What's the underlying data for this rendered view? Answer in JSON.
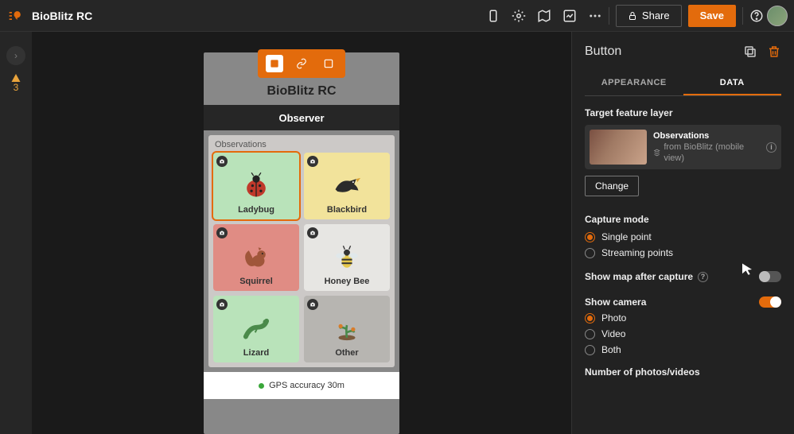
{
  "header": {
    "app_title": "BioBlitz RC",
    "share_label": "Share",
    "save_label": "Save"
  },
  "left_rail": {
    "warning_count": "3"
  },
  "phone": {
    "title": "BioBlitz RC",
    "observer_label": "Observer",
    "observations_title": "Observations",
    "gps_status": "GPS accuracy 30m",
    "cards": [
      {
        "label": "Ladybug",
        "bg": "#b9e3ba",
        "selected": true
      },
      {
        "label": "Blackbird",
        "bg": "#f2e39b",
        "selected": false
      },
      {
        "label": "Squirrel",
        "bg": "#e08c84",
        "selected": false
      },
      {
        "label": "Honey Bee",
        "bg": "#e7e6e3",
        "selected": false
      },
      {
        "label": "Lizard",
        "bg": "#b9e3ba",
        "selected": false
      },
      {
        "label": "Other",
        "bg": "#b7b5b1",
        "selected": false
      }
    ]
  },
  "panel": {
    "title": "Button",
    "tabs": {
      "appearance": "APPEARANCE",
      "data": "DATA"
    },
    "target_label": "Target feature layer",
    "layer_name": "Observations",
    "layer_source": "from BioBlitz (mobile view)",
    "change_label": "Change",
    "capture_mode_label": "Capture mode",
    "capture_options": {
      "single": "Single point",
      "streaming": "Streaming points"
    },
    "show_map_label": "Show map after capture",
    "show_camera_label": "Show camera",
    "camera_options": {
      "photo": "Photo",
      "video": "Video",
      "both": "Both"
    },
    "num_photos_label": "Number of photos/videos"
  }
}
